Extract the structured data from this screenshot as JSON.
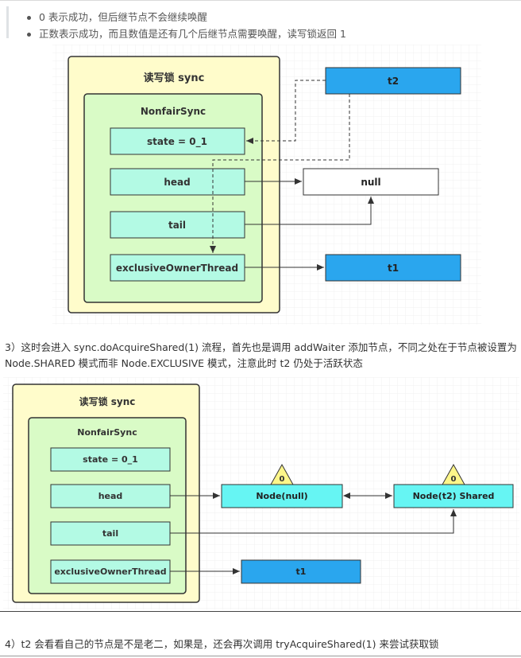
{
  "bullets": [
    "0 表示成功，但后继节点不会继续唤醒",
    "正数表示成功，而且数值是还有几个后继节点需要唤醒，读写锁返回 1"
  ],
  "diagram1": {
    "outer_title": "读写锁 sync",
    "inner_title": "NonfairSync",
    "fields": [
      "state = 0_1",
      "head",
      "tail",
      "exclusiveOwnerThread"
    ],
    "t2": "t2",
    "null_box": "null",
    "t1": "t1"
  },
  "paragraph3": "3）这时会进入 sync.doAcquireShared(1) 流程，首先也是调用 addWaiter 添加节点，不同之处在于节点被设置为 Node.SHARED 模式而非 Node.EXCLUSIVE 模式，注意此时 t2 仍处于活跃状态",
  "diagram2": {
    "outer_title": "读写锁 sync",
    "inner_title": "NonfairSync",
    "fields": [
      "state = 0_1",
      "head",
      "tail",
      "exclusiveOwnerThread"
    ],
    "node_null": "Node(null)",
    "node_t2": "Node(t2) Shared",
    "waitstatus_1": "0",
    "waitstatus_2": "0",
    "t1": "t1"
  },
  "paragraph4": "4）t2 会看看自己的节点是不是老二，如果是，还会再次调用 tryAcquireShared(1) 来尝试获取锁",
  "colors": {
    "outer_fill": "#fffccb",
    "inner_fill": "#d9fbc6",
    "field_fill": "#b3fae4",
    "thread_fill": "#2aa6ee",
    "node_fill": "#66f5f3",
    "triangle_fill": "#fdf68a"
  }
}
